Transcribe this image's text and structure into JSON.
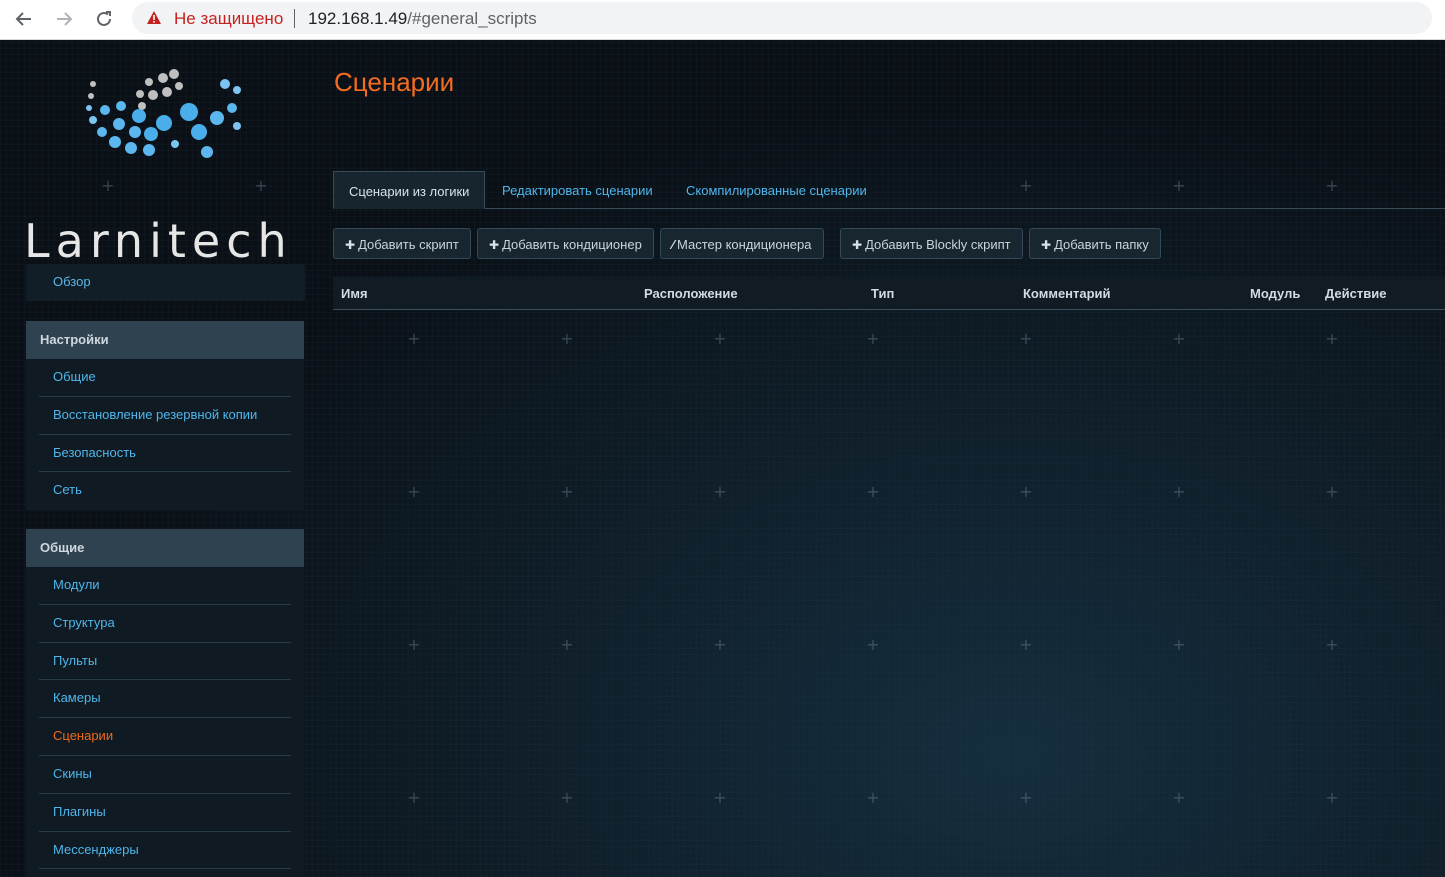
{
  "browser": {
    "security_label": "Не защищено",
    "url_host": "192.168.1.49",
    "url_path": "/#general_scripts"
  },
  "logo": {
    "text": "Larnitech"
  },
  "sidebar": {
    "overview": "Обзор",
    "settings_group": {
      "title": "Настройки",
      "items": [
        "Общие",
        "Восстановление резервной копии",
        "Безопасность",
        "Сеть"
      ]
    },
    "general_group": {
      "title": "Общие",
      "items": [
        "Модули",
        "Структура",
        "Пульты",
        "Камеры",
        "Сценарии",
        "Скины",
        "Плагины",
        "Мессенджеры"
      ],
      "active": "Сценарии"
    }
  },
  "main": {
    "title": "Сценарии",
    "tabs": [
      "Сценарии из логики",
      "Редактировать сценарии",
      "Скомпилированные сценарии"
    ],
    "active_tab": "Сценарии из логики",
    "buttons": [
      {
        "icon": "plus-icon",
        "label": "Добавить скрипт"
      },
      {
        "icon": "plus-icon",
        "label": "Добавить кондиционер"
      },
      {
        "icon": "magic-wand-icon",
        "label": "Мастер кондиционера"
      },
      {
        "icon": "plus-icon",
        "label": "Добавить Blockly скрипт"
      },
      {
        "icon": "plus-icon",
        "label": "Добавить папку"
      }
    ],
    "table": {
      "columns": [
        "Имя",
        "Расположение",
        "Тип",
        "Комментарий",
        "Модуль",
        "Действие"
      ],
      "rows": []
    }
  },
  "colors": {
    "accent_orange": "#f26d21",
    "link_blue": "#4fb6ec",
    "background": "#0a1016",
    "group_header": "#2e4250"
  }
}
